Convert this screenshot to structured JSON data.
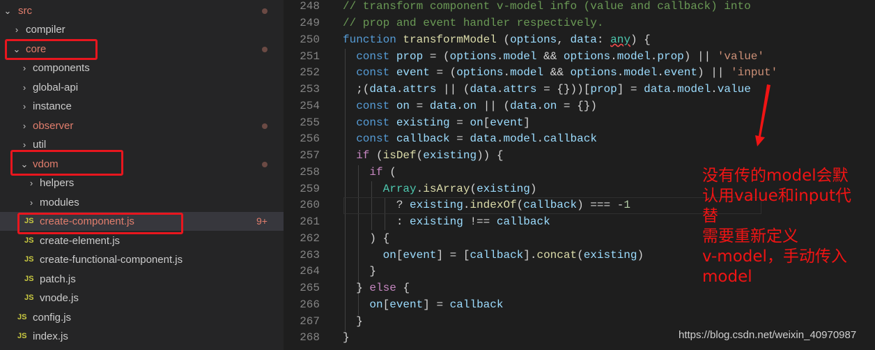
{
  "explorer": {
    "items": [
      {
        "label": "src",
        "type": "folder-open",
        "modified": true
      },
      {
        "label": "compiler",
        "type": "folder",
        "modified": false
      },
      {
        "label": "core",
        "type": "folder-open",
        "modified": true
      },
      {
        "label": "components",
        "type": "folder",
        "modified": false
      },
      {
        "label": "global-api",
        "type": "folder",
        "modified": false
      },
      {
        "label": "instance",
        "type": "folder",
        "modified": false
      },
      {
        "label": "observer",
        "type": "folder",
        "modified": true
      },
      {
        "label": "util",
        "type": "folder",
        "modified": false
      },
      {
        "label": "vdom",
        "type": "folder-open",
        "modified": true
      },
      {
        "label": "helpers",
        "type": "folder",
        "modified": false
      },
      {
        "label": "modules",
        "type": "folder",
        "modified": false
      },
      {
        "label": "create-component.js",
        "type": "js",
        "modified": true,
        "badge": "9+"
      },
      {
        "label": "create-element.js",
        "type": "js",
        "modified": false
      },
      {
        "label": "create-functional-component.js",
        "type": "js",
        "modified": false
      },
      {
        "label": "patch.js",
        "type": "js",
        "modified": false
      },
      {
        "label": "vnode.js",
        "type": "js",
        "modified": false
      },
      {
        "label": "config.js",
        "type": "js",
        "modified": false
      },
      {
        "label": "index.js",
        "type": "js",
        "modified": false
      }
    ],
    "js_icon_text": "JS"
  },
  "editor": {
    "line_numbers": [
      "248",
      "249",
      "250",
      "251",
      "252",
      "253",
      "254",
      "255",
      "256",
      "257",
      "258",
      "259",
      "260",
      "261",
      "262",
      "263",
      "264",
      "265",
      "266",
      "267",
      "268"
    ]
  },
  "annotation": {
    "lines": [
      "没有传的model会默",
      "认用value和input代",
      "替",
      "需要重新定义",
      "v-model，手动传入",
      "model"
    ]
  },
  "watermark": "https://blog.csdn.net/weixin_40970987",
  "colors": {
    "annotation_red": "#e8161e",
    "modified_text": "#e27e6d"
  }
}
